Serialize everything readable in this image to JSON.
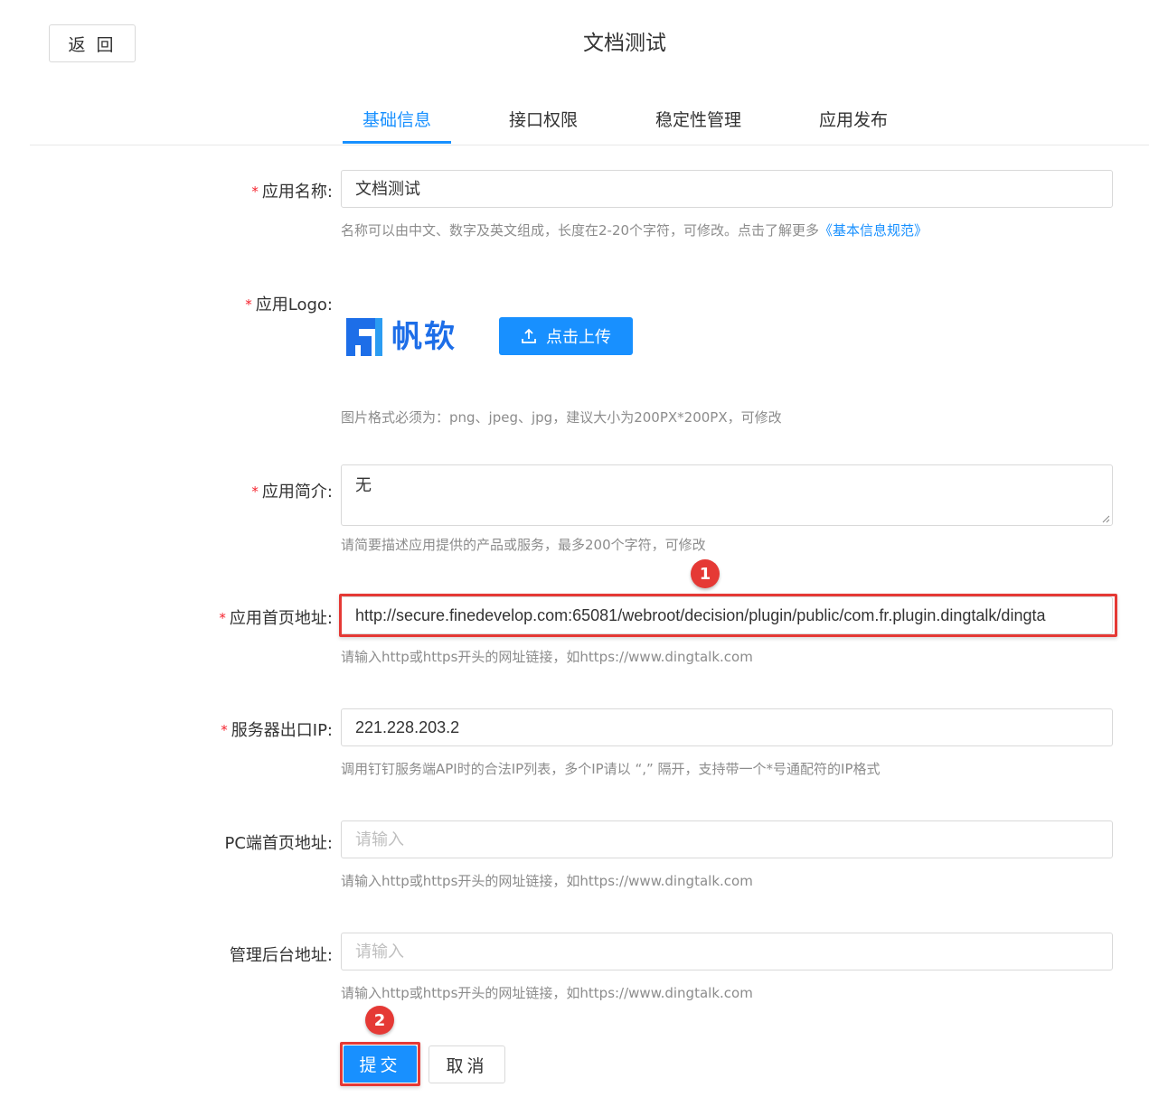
{
  "header": {
    "back_label": "返 回",
    "title": "文档测试"
  },
  "tabs": [
    {
      "label": "基础信息",
      "active": true
    },
    {
      "label": "接口权限",
      "active": false
    },
    {
      "label": "稳定性管理",
      "active": false
    },
    {
      "label": "应用发布",
      "active": false
    }
  ],
  "form": {
    "required_mark": "*",
    "app_name": {
      "label": "应用名称:",
      "value": "文档测试",
      "hint": "名称可以由中文、数字及英文组成，长度在2-20个字符，可修改。点击了解更多",
      "hint_link": "《基本信息规范》"
    },
    "app_logo": {
      "label": "应用Logo:",
      "logo_text": "帆软",
      "upload_label": "点击上传",
      "hint": "图片格式必须为：png、jpeg、jpg，建议大小为200PX*200PX，可修改"
    },
    "app_intro": {
      "label": "应用简介:",
      "value": "无",
      "hint": "请简要描述应用提供的产品或服务，最多200个字符，可修改"
    },
    "homepage_url": {
      "label": "应用首页地址:",
      "value": "http://secure.finedevelop.com:65081/webroot/decision/plugin/public/com.fr.plugin.dingtalk/dingta",
      "hint": "请输入http或https开头的网址链接，如https://www.dingtalk.com"
    },
    "server_ip": {
      "label": "服务器出口IP:",
      "value": "221.228.203.2",
      "hint": "调用钉钉服务端API时的合法IP列表，多个IP请以 “,” 隔开，支持带一个*号通配符的IP格式"
    },
    "pc_homepage": {
      "label": "PC端首页地址:",
      "placeholder": "请输入",
      "hint": "请输入http或https开头的网址链接，如https://www.dingtalk.com"
    },
    "admin_url": {
      "label": "管理后台地址:",
      "placeholder": "请输入",
      "hint": "请输入http或https开头的网址链接，如https://www.dingtalk.com"
    }
  },
  "actions": {
    "submit_label": "提交",
    "cancel_label": "取消"
  },
  "annotations": {
    "step1": "1",
    "step2": "2"
  },
  "colors": {
    "primary": "#1890ff",
    "required": "#f5222d",
    "annotation": "#e53935",
    "logo_blue": "#1d6ee8"
  }
}
